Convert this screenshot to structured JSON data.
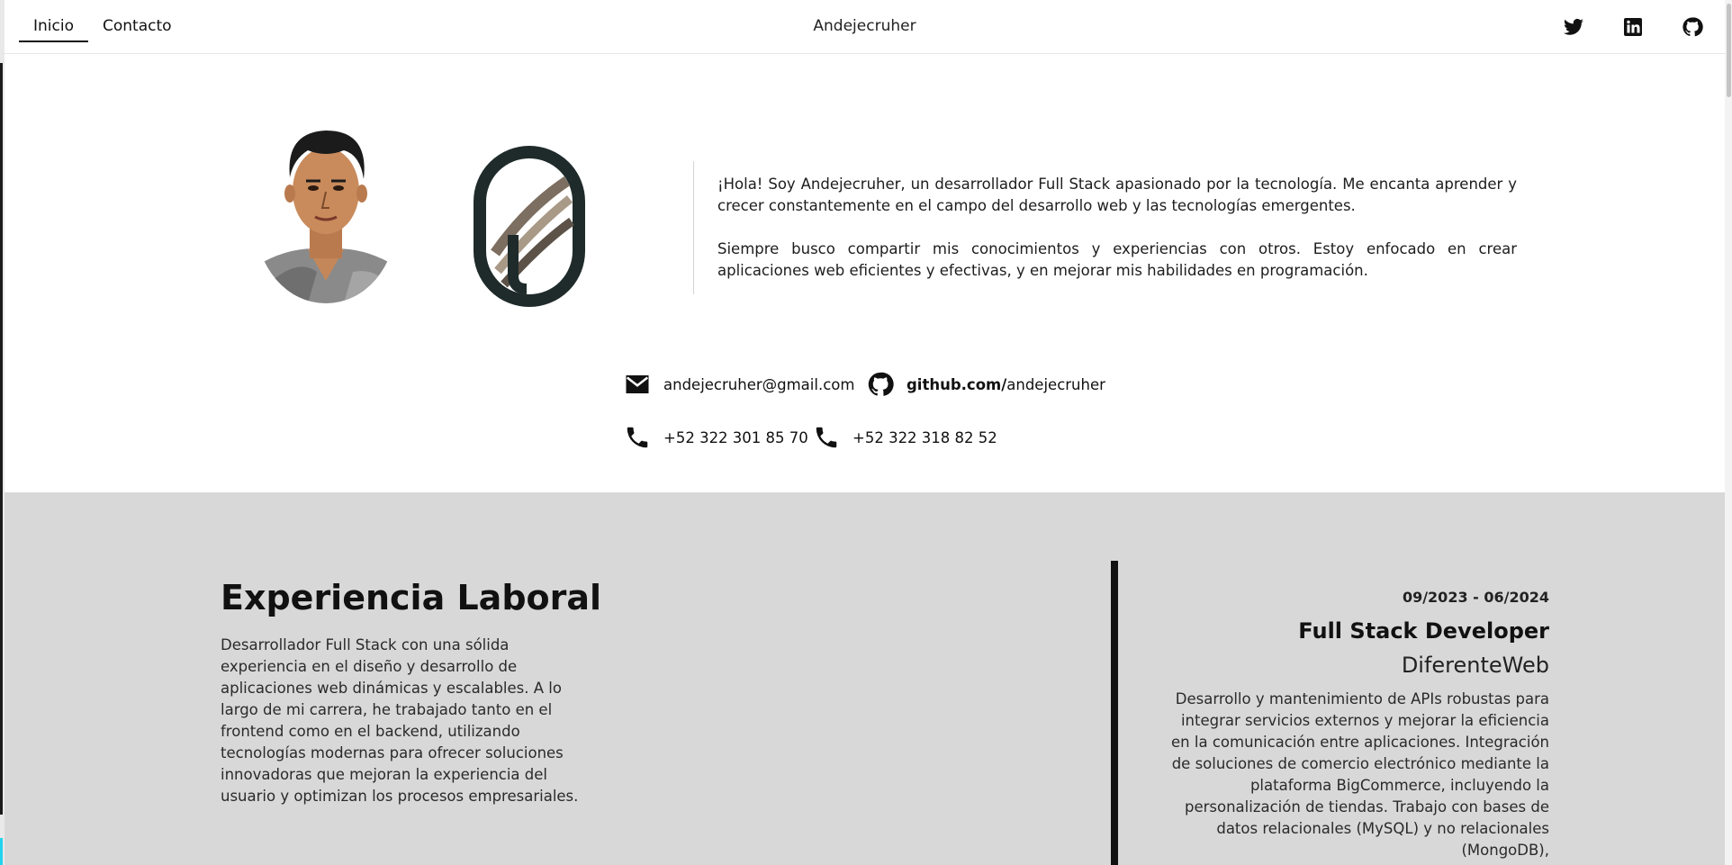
{
  "nav": {
    "items": [
      {
        "label": "Inicio",
        "active": true
      },
      {
        "label": "Contacto",
        "active": false
      }
    ],
    "brand": "Andejecruher",
    "social_icons": [
      "twitter-icon",
      "linkedin-icon",
      "github-icon"
    ]
  },
  "hero": {
    "intro": [
      "¡Hola! Soy Andejecruher, un desarrollador Full Stack apasionado por la tecnología. Me encanta aprender y crecer constantemente en el campo del desarrollo web y las tecnologías emergentes.",
      "Siempre busco compartir mis conocimientos y experiencias con otros. Estoy enfocado en crear aplicaciones web eficientes y efectivas, y en mejorar mis habilidades en programación."
    ]
  },
  "contacts": {
    "email": "andejecruher@gmail.com",
    "github_bold": "github.com/",
    "github_user": "andejecruher",
    "phone1": "+52 322 301 85 70",
    "phone2": "+52 322 318 82 52"
  },
  "experience": {
    "title": "Experiencia Laboral",
    "description": "Desarrollador Full Stack con una sólida experiencia en el diseño y desarrollo de aplicaciones web dinámicas y escalables. A lo largo de mi carrera, he trabajado tanto en el frontend como en el backend, utilizando tecnologías modernas para ofrecer soluciones innovadoras que mejoran la experiencia del usuario y optimizan los procesos empresariales.",
    "jobs": [
      {
        "dates": "09/2023 - 06/2024",
        "role": "Full Stack Developer",
        "company": "DiferenteWeb",
        "description": "Desarrollo y mantenimiento de APIs robustas para integrar servicios externos y mejorar la eficiencia en la comunicación entre aplicaciones. Integración de soluciones de comercio electrónico mediante la plataforma BigCommerce, incluyendo la personalización de tiendas. Trabajo con bases de datos relacionales (MySQL) y no relacionales (MongoDB),"
      }
    ]
  },
  "colors": {
    "experience_bg": "#d8d8d8",
    "text": "#111111",
    "accent_cyan": "#22d3ee"
  }
}
